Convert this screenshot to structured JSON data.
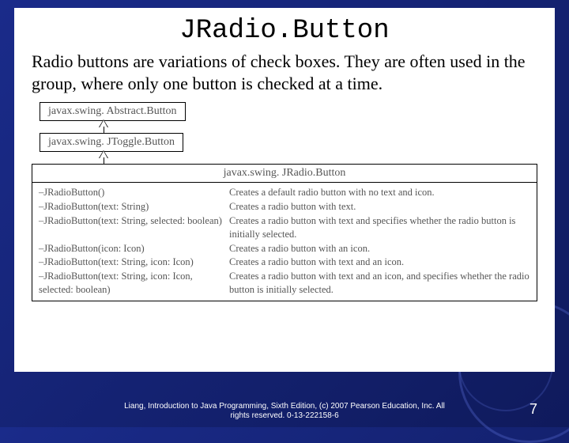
{
  "title": "JRadio.Button",
  "intro": "Radio buttons are variations of check boxes. They are often used in the group, where only one button is checked at a time.",
  "hierarchy": {
    "level1": "javax.swing. Abstract.Button",
    "level2": "javax.swing. JToggle.Button",
    "level3": "javax.swing. JRadio.Button"
  },
  "constructors": [
    {
      "sig": "–JRadioButton()",
      "desc": "Creates a default radio button with no text and icon."
    },
    {
      "sig": "–JRadioButton(text: String)",
      "desc": "Creates a radio button with text."
    },
    {
      "sig": "–JRadioButton(text: String, selected: boolean)",
      "desc": "Creates a radio button with text and specifies whether the radio button is initially selected."
    },
    {
      "sig": "–JRadioButton(icon: Icon)",
      "desc": "Creates a radio button with an icon."
    },
    {
      "sig": "–JRadioButton(text: String, icon: Icon)",
      "desc": "Creates a radio button with text and an icon."
    },
    {
      "sig": "–JRadioButton(text: String, icon: Icon, selected: boolean)",
      "desc": "Creates a radio button with text and an icon, and specifies whether the radio button is initially selected."
    }
  ],
  "footer": {
    "line1": "Liang, Introduction to Java Programming, Sixth Edition, (c) 2007 Pearson Education, Inc. All",
    "line2": "rights reserved. 0-13-222158-6"
  },
  "pagenum": "7"
}
